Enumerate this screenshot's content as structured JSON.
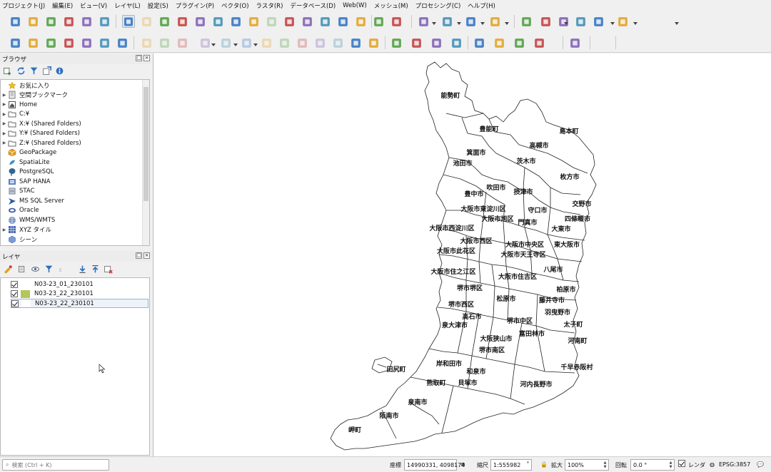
{
  "menubar": {
    "items": [
      {
        "label": "プロジェクト(J)"
      },
      {
        "label": "編集(E)"
      },
      {
        "label": "ビュー(V)"
      },
      {
        "label": "レイヤ(L)"
      },
      {
        "label": "設定(S)"
      },
      {
        "label": "プラグイン(P)"
      },
      {
        "label": "ベクタ(O)"
      },
      {
        "label": "ラスタ(R)"
      },
      {
        "label": "データベース(D)"
      },
      {
        "label": "Web(W)"
      },
      {
        "label": "メッシュ(M)"
      },
      {
        "label": "プロセシング(C)"
      },
      {
        "label": "ヘルプ(H)"
      }
    ]
  },
  "toolbar1_icons": [
    "new-project",
    "open-project",
    "save-project",
    "save-as",
    "print-layout",
    "layout-manager",
    "pan-tool",
    "pan-to-selection",
    "zoom-in",
    "zoom-out",
    "zoom-full",
    "zoom-to-selection",
    "zoom-to-layer",
    "zoom-native",
    "zoom-last",
    "zoom-next",
    "new-map-view",
    "new-3d-view",
    "temporal-controller",
    "refresh",
    "select-features",
    "deselect",
    "select-by-value",
    "select-by-location",
    "identify",
    "attribute-table",
    "processing-toolbox",
    "statistics",
    "field-calculator",
    "measure",
    "annotation",
    "map-tips"
  ],
  "toolbar2_icons": [
    "data-source-manager",
    "new-geopackage",
    "new-shapefile",
    "new-spatialite",
    "new-memory-layer",
    "new-virtual-layer",
    "current-edits",
    "toggle-editing",
    "save-edits",
    "digitize",
    "move-feature",
    "node-tool",
    "delete-selected",
    "cut",
    "copy",
    "paste",
    "undo",
    "redo",
    "label-toolbar",
    "layer-labeling",
    "highlight-pinned",
    "pin-labels",
    "show-labels",
    "move-label",
    "rotate-label",
    "change-label",
    "python-console",
    "metasearch",
    "help"
  ],
  "browser": {
    "title": "ブラウザ",
    "items": [
      {
        "label": "お気に入り",
        "icon": "star-icon",
        "expandable": false
      },
      {
        "label": "空間ブックマーク",
        "icon": "bookmark-icon",
        "expandable": true
      },
      {
        "label": "Home",
        "icon": "home-icon",
        "expandable": true
      },
      {
        "label": "C:¥",
        "icon": "folder-icon",
        "expandable": true
      },
      {
        "label": "X:¥ (Shared Folders)",
        "icon": "folder-icon",
        "expandable": true
      },
      {
        "label": "Y:¥ (Shared Folders)",
        "icon": "folder-icon",
        "expandable": true
      },
      {
        "label": "Z:¥ (Shared Folders)",
        "icon": "folder-icon",
        "expandable": true
      },
      {
        "label": "GeoPackage",
        "icon": "geopackage-icon",
        "expandable": false
      },
      {
        "label": "SpatiaLite",
        "icon": "spatialite-icon",
        "expandable": false
      },
      {
        "label": "PostgreSQL",
        "icon": "postgresql-icon",
        "expandable": false
      },
      {
        "label": "SAP HANA",
        "icon": "sap-hana-icon",
        "expandable": false
      },
      {
        "label": "STAC",
        "icon": "stac-icon",
        "expandable": false
      },
      {
        "label": "MS SQL Server",
        "icon": "mssql-icon",
        "expandable": false
      },
      {
        "label": "Oracle",
        "icon": "oracle-icon",
        "expandable": false
      },
      {
        "label": "WMS/WMTS",
        "icon": "wms-icon",
        "expandable": false
      },
      {
        "label": "XYZ タイル",
        "icon": "xyz-tiles-icon",
        "expandable": true
      },
      {
        "label": "シーン",
        "icon": "scene-icon",
        "expandable": false
      }
    ]
  },
  "layers": {
    "title": "レイヤ",
    "items": [
      {
        "label": "N03-23_01_230101",
        "color": "#ffffff",
        "checked": true
      },
      {
        "label": "N03-23_22_230101",
        "color": "#b5c55a",
        "checked": true
      },
      {
        "label": "N03-23_22_230101",
        "color": "#ffffff",
        "checked": true
      }
    ]
  },
  "map_labels": [
    "能勢町",
    "豊能町",
    "島本町",
    "高槻市",
    "箕面市",
    "池田市",
    "茨木市",
    "枚方市",
    "吹田市",
    "豊中市",
    "摂津市",
    "交野市",
    "大阪市東淀川区",
    "守口市",
    "大阪市旭区",
    "四條畷市",
    "大阪市西淀川区",
    "門真市",
    "大東市",
    "大阪市西区",
    "大阪市中央区",
    "東大阪市",
    "大阪市此花区",
    "大阪市天王寺区",
    "八尾市",
    "大阪市住之江区",
    "大阪市住吉区",
    "堺市堺区",
    "柏原市",
    "松原市",
    "藤井寺市",
    "堺市西区",
    "羽曳野市",
    "高石市",
    "堺市中区",
    "太子町",
    "泉大津市",
    "富田林市",
    "大阪狭山市",
    "河南町",
    "堺市南区",
    "岸和田市",
    "千早赤阪村",
    "田尻町",
    "和泉市",
    "熊取町",
    "貝塚市",
    "河内長野市",
    "泉南市",
    "阪南市",
    "岬町"
  ],
  "statusbar": {
    "locator_placeholder": "検索 (Ctrl + K)",
    "coord_label": "座標",
    "coord_value": "14990331, 4098174",
    "scale_label": "縮尺",
    "scale_value": "1:555982",
    "magnify_label": "拡大",
    "magnify_value": "100%",
    "rotation_label": "回転",
    "rotation_value": "0.0 °",
    "render_label": "レンダ",
    "crs_value": "EPSG:3857"
  }
}
